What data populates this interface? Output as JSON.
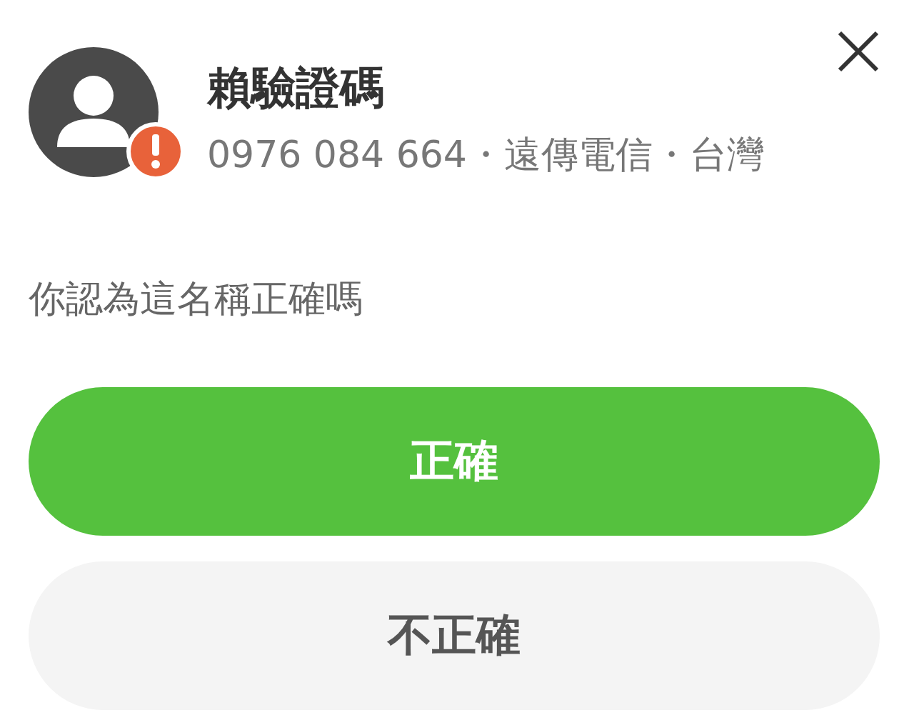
{
  "caller": {
    "name": "賴驗證碼",
    "details": "0976 084 664・遠傳電信・台灣",
    "warning": true
  },
  "question": "你認為這名稱正確嗎",
  "buttons": [
    {
      "label": "正確",
      "kind": "primary"
    },
    {
      "label": "不正確",
      "kind": "secondary"
    }
  ]
}
